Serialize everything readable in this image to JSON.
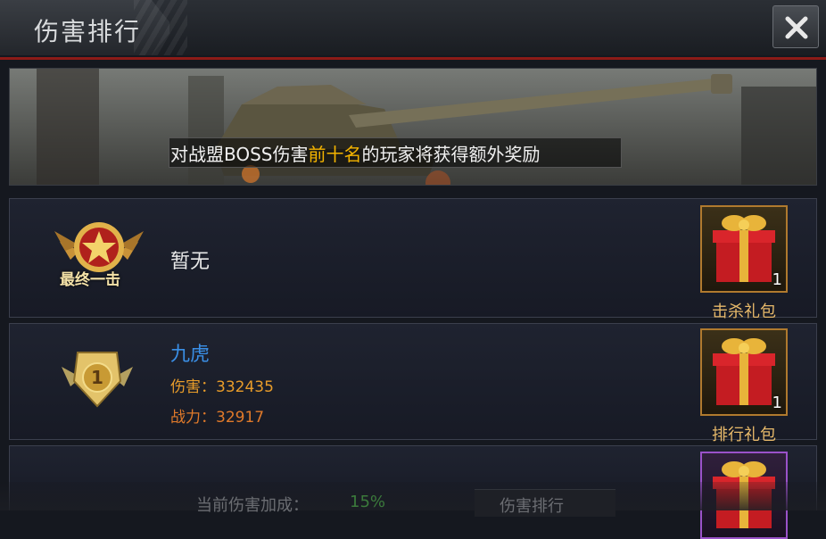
{
  "header": {
    "title": "伤害排行"
  },
  "banner": {
    "text_before": "对战盟BOSS伤害",
    "text_highlight": "前十名",
    "text_after": "的玩家将获得额外奖励"
  },
  "rows": [
    {
      "emblem_text": "最终一击",
      "player": "暂无",
      "reward_count": "1",
      "reward_label": "击杀礼包"
    },
    {
      "rank": "1",
      "player": "九虎",
      "damage_label": "伤害：",
      "damage": "332435",
      "power_label": "战力：",
      "power": "32917",
      "reward_count": "1",
      "reward_label": "排行礼包"
    }
  ],
  "footer": {
    "bonus_label": "当前伤害加成：",
    "bonus_value": "15%",
    "button_label": "伤害排行"
  },
  "colors": {
    "accent_red": "#8c1b17",
    "highlight": "#f4b400",
    "player_name": "#3a8fe6",
    "stat": "#e89c2a",
    "gift_border_gold": "#b07a2e",
    "gift_border_purple": "#9a52c9"
  }
}
